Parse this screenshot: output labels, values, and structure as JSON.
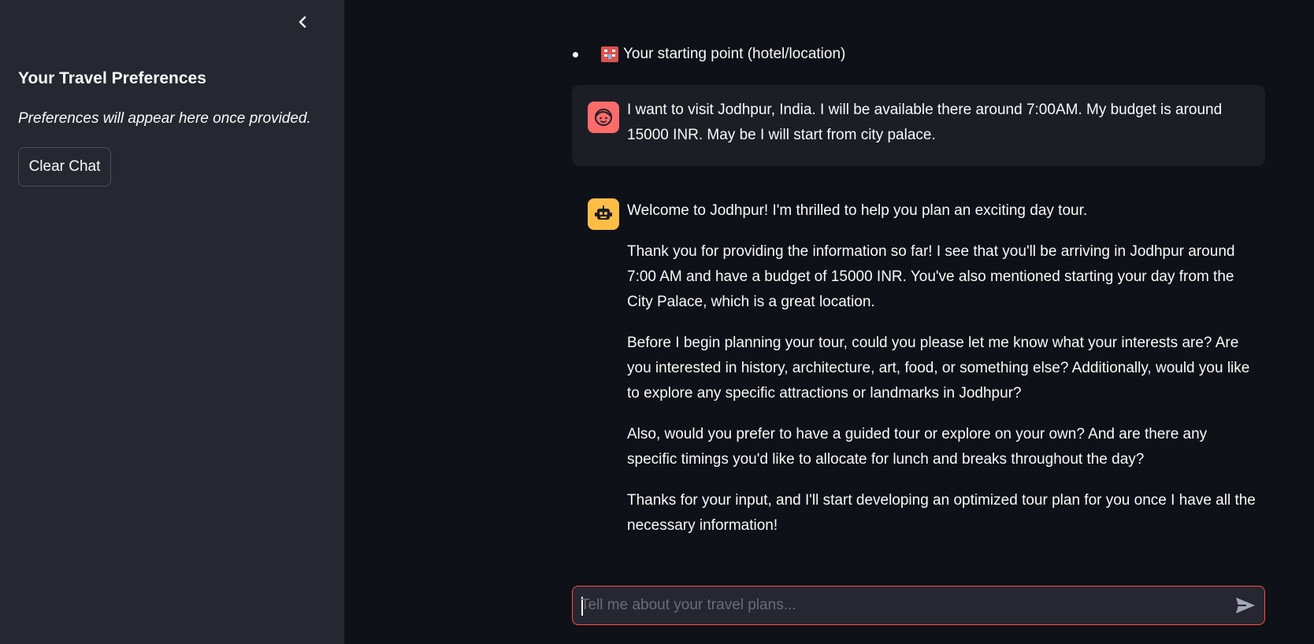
{
  "sidebar": {
    "title": "Your Travel Preferences",
    "note": "Preferences will appear here once provided.",
    "clear_button": "Clear Chat"
  },
  "chat": {
    "bullet_item": "Your starting point (hotel/location)",
    "user_message": "I want to visit Jodhpur, India. I will be available there around 7:00AM. My budget is around 15000 INR. May be I will start from city palace.",
    "assistant_paragraphs": [
      "Welcome to Jodhpur! I'm thrilled to help you plan an exciting day tour.",
      "Thank you for providing the information so far! I see that you'll be arriving in Jodhpur around 7:00 AM and have a budget of 15000 INR. You've also mentioned starting your day from the City Palace, which is a great location.",
      "Before I begin planning your tour, could you please let me know what your interests are? Are you interested in history, architecture, art, food, or something else? Additionally, would you like to explore any specific attractions or landmarks in Jodhpur?",
      "Also, would you prefer to have a guided tour or explore on your own? And are there any specific timings you'd like to allocate for lunch and breaks throughout the day?",
      "Thanks for your input, and I'll start developing an optimized tour plan for you once I have all the necessary information!"
    ],
    "input_placeholder": "Tell me about your travel plans...",
    "input_value": ""
  },
  "colors": {
    "sidebar_bg": "#262730",
    "main_bg": "#0e1117",
    "user_avatar": "#ff6b6b",
    "bot_avatar": "#ffbd45",
    "input_border": "#ff4b4b"
  },
  "icons": {
    "collapse": "chevron-left-icon",
    "hotel": "hotel-icon",
    "user_avatar": "user-face-icon",
    "bot_avatar": "robot-icon",
    "send": "send-icon"
  }
}
